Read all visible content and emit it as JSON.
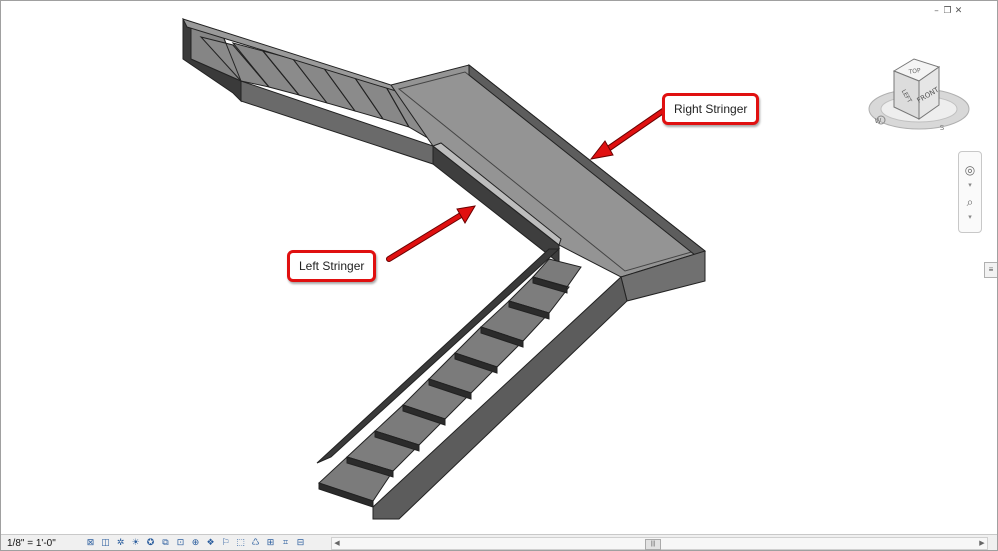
{
  "window": {
    "controls": {
      "minimize": "–",
      "restore": "❐",
      "close": "✕"
    }
  },
  "callouts": {
    "right_stringer": "Right Stringer",
    "left_stringer": "Left Stringer"
  },
  "viewcube": {
    "top_face": "TOP",
    "front_face": "FRONT",
    "left_face": "LEFT",
    "compass_w": "W",
    "compass_s": "S"
  },
  "status": {
    "scale": "1/8\" = 1'-0\""
  },
  "colors": {
    "callout_border": "#e01010",
    "stair_tread": "#7f7f7f",
    "stair_riser": "#2f2f2f",
    "landing": "#929292",
    "stringer_side": "#5a5a5a"
  }
}
